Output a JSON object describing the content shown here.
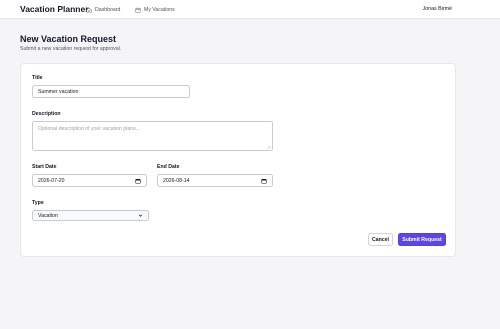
{
  "header": {
    "brand": "Vacation Planner",
    "nav": [
      {
        "label": "Dashboard",
        "icon": "home-icon"
      },
      {
        "label": "My Vacations",
        "icon": "calendar-icon"
      }
    ],
    "user_name": "Jonas Birmé"
  },
  "page": {
    "title": "New Vacation Request",
    "subtitle": "Submit a new vacation request for approval."
  },
  "form": {
    "title_label": "Title",
    "title_value": "Summer vacation",
    "description_label": "Description",
    "description_placeholder": "Optional description of your vacation plans...",
    "start_date_label": "Start Date",
    "start_date_value": "2026-07-20",
    "end_date_label": "End Date",
    "end_date_value": "2026-08-14",
    "type_label": "Type",
    "type_value": "Vacation",
    "cancel_label": "Cancel",
    "submit_label": "Submit Request"
  },
  "colors": {
    "accent": "#6046e0",
    "background": "#f5f5f7",
    "card": "#ffffff"
  }
}
